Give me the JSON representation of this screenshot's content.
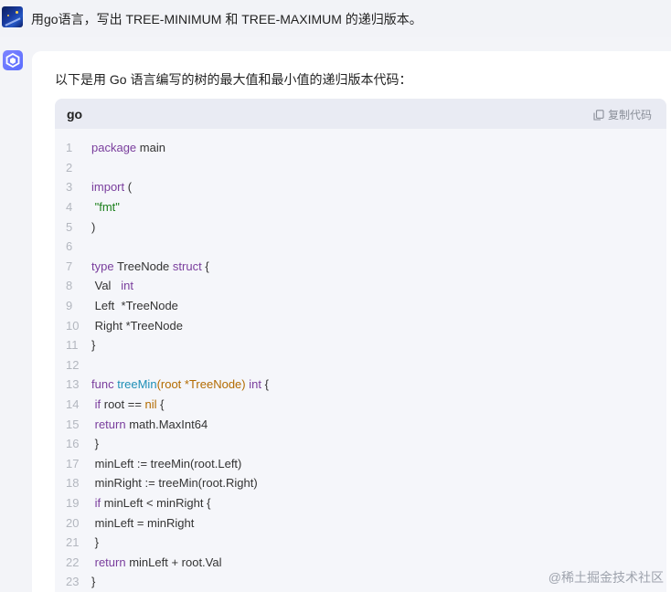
{
  "user_message": "用go语言，写出 TREE-MINIMUM 和 TREE-MAXIMUM 的递归版本。",
  "answer_intro": "以下是用 Go 语言编写的树的最大值和最小值的递归版本代码：",
  "code_block": {
    "language": "go",
    "copy_label": "复制代码",
    "lines": [
      {
        "n": "1",
        "parts": [
          {
            "t": "package",
            "c": "kw"
          },
          {
            "t": " main",
            "c": ""
          }
        ]
      },
      {
        "n": "2",
        "parts": []
      },
      {
        "n": "3",
        "parts": [
          {
            "t": "import",
            "c": "kw"
          },
          {
            "t": " (",
            "c": ""
          }
        ]
      },
      {
        "n": "4",
        "parts": [
          {
            "t": " ",
            "c": ""
          },
          {
            "t": "\"fmt\"",
            "c": "str"
          }
        ]
      },
      {
        "n": "5",
        "parts": [
          {
            "t": ")",
            "c": ""
          }
        ]
      },
      {
        "n": "6",
        "parts": []
      },
      {
        "n": "7",
        "parts": [
          {
            "t": "type",
            "c": "kw"
          },
          {
            "t": " TreeNode ",
            "c": ""
          },
          {
            "t": "struct",
            "c": "kw"
          },
          {
            "t": " {",
            "c": ""
          }
        ]
      },
      {
        "n": "8",
        "parts": [
          {
            "t": " Val   ",
            "c": ""
          },
          {
            "t": "int",
            "c": "kw"
          }
        ]
      },
      {
        "n": "9",
        "parts": [
          {
            "t": " Left  *TreeNode",
            "c": ""
          }
        ]
      },
      {
        "n": "10",
        "parts": [
          {
            "t": " Right *TreeNode",
            "c": ""
          }
        ]
      },
      {
        "n": "11",
        "parts": [
          {
            "t": "}",
            "c": ""
          }
        ]
      },
      {
        "n": "12",
        "parts": []
      },
      {
        "n": "13",
        "parts": [
          {
            "t": "func",
            "c": "kw"
          },
          {
            "t": " ",
            "c": ""
          },
          {
            "t": "treeMin",
            "c": "fn"
          },
          {
            "t": "(root *TreeNode) ",
            "c": "ty"
          },
          {
            "t": "int",
            "c": "kw"
          },
          {
            "t": " {",
            "c": ""
          }
        ]
      },
      {
        "n": "14",
        "parts": [
          {
            "t": " ",
            "c": ""
          },
          {
            "t": "if",
            "c": "kw"
          },
          {
            "t": " root == ",
            "c": ""
          },
          {
            "t": "nil",
            "c": "ty"
          },
          {
            "t": " {",
            "c": ""
          }
        ]
      },
      {
        "n": "15",
        "parts": [
          {
            "t": " ",
            "c": ""
          },
          {
            "t": "return",
            "c": "kw"
          },
          {
            "t": " math.MaxInt64",
            "c": ""
          }
        ]
      },
      {
        "n": "16",
        "parts": [
          {
            "t": " }",
            "c": ""
          }
        ]
      },
      {
        "n": "17",
        "parts": [
          {
            "t": " minLeft := treeMin(root.Left)",
            "c": ""
          }
        ]
      },
      {
        "n": "18",
        "parts": [
          {
            "t": " minRight := treeMin(root.Right)",
            "c": ""
          }
        ]
      },
      {
        "n": "19",
        "parts": [
          {
            "t": " ",
            "c": ""
          },
          {
            "t": "if",
            "c": "kw"
          },
          {
            "t": " minLeft < minRight {",
            "c": ""
          }
        ]
      },
      {
        "n": "20",
        "parts": [
          {
            "t": " minLeft = minRight",
            "c": ""
          }
        ]
      },
      {
        "n": "21",
        "parts": [
          {
            "t": " }",
            "c": ""
          }
        ]
      },
      {
        "n": "22",
        "parts": [
          {
            "t": " ",
            "c": ""
          },
          {
            "t": "return",
            "c": "kw"
          },
          {
            "t": " minLeft + root.Val",
            "c": ""
          }
        ]
      },
      {
        "n": "23",
        "parts": [
          {
            "t": "}",
            "c": ""
          }
        ]
      }
    ]
  },
  "watermark": "@稀土掘金技术社区",
  "colors": {
    "keyword": "#7a3e9d",
    "function": "#1f8fb7",
    "type": "#b36b00",
    "string": "#1a7f1a"
  }
}
